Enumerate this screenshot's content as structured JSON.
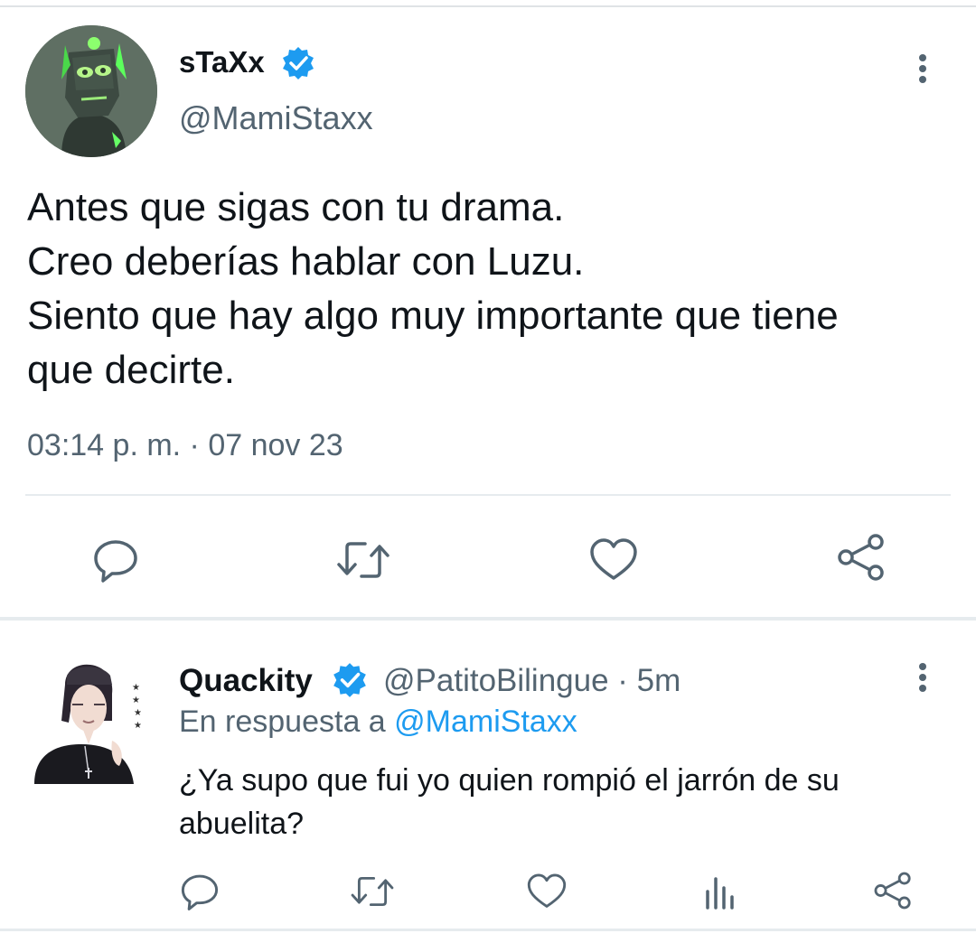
{
  "tweet": {
    "author_name": "sTaXx",
    "author_handle": "@MamiStaxx",
    "text_lines": [
      "Antes que sigas con tu drama.",
      "Creo deberías hablar con Luzu.",
      "Siento que hay algo muy importante que tiene",
      "que decirte."
    ],
    "timestamp": "03:14 p. m. · 07 nov 23",
    "actions": [
      "reply-icon",
      "retweet-icon",
      "like-icon",
      "share-icon"
    ]
  },
  "reply": {
    "author_name": "Quackity",
    "author_handle": "@PatitoBilingue · 5m",
    "replying_prefix": "En respuesta a ",
    "replying_handle": "@MamiStaxx",
    "text": "¿Ya supo que fui yo quien rompió el jarrón de su abuelita?",
    "actions": [
      "reply-icon",
      "retweet-icon",
      "like-icon",
      "analytics-icon",
      "share-icon"
    ]
  },
  "colors": {
    "text": "#0f1419",
    "secondary": "#536471",
    "accent": "#1d9bf0",
    "divider": "#e6ebee"
  }
}
